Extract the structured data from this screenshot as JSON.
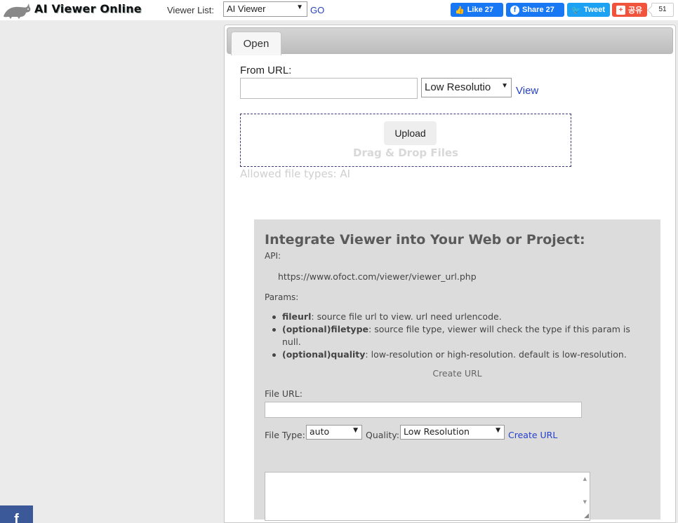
{
  "header": {
    "logo_text": "AI Viewer Online",
    "viewer_list_label": "Viewer List:",
    "viewer_select_value": "AI Viewer",
    "go_label": "GO",
    "social": {
      "like_label": "Like 27",
      "share_label": "Share 27",
      "tweet_label": "Tweet",
      "kakao_share_label": "공유",
      "count": "51"
    }
  },
  "tabs": [
    {
      "label": "Open"
    }
  ],
  "open_panel": {
    "from_url_label": "From URL:",
    "url_input_value": "",
    "resolution_select_value": "Low Resolutio",
    "view_label": "View",
    "upload_label": "Upload",
    "drag_drop_text": "Drag & Drop Files",
    "allowed_text": "Allowed file types: AI"
  },
  "integrate": {
    "title": "Integrate Viewer into Your Web or Project:",
    "api_label": "API:",
    "api_url": "https://www.ofoct.com/viewer/viewer_url.php",
    "params_label": "Params:",
    "params": [
      {
        "name": "fileurl",
        "desc": ": source file url to view. url need urlencode."
      },
      {
        "name": "(optional)filetype",
        "desc": ": source file type, viewer will check the type if this param is null."
      },
      {
        "name": "(optional)quality",
        "desc": ": low-resolution or high-resolution. default is low-resolution."
      }
    ],
    "create_url_caption": "Create URL",
    "file_url_label": "File URL:",
    "file_url_value": "",
    "file_type_label": "File Type:",
    "file_type_value": "auto",
    "quality_label": "Quality:",
    "quality_value": "Low Resolution",
    "create_url_link": "Create URL"
  },
  "floating": {
    "facebook_glyph": "f"
  },
  "colors": {
    "link": "#2540c8",
    "facebook": "#1877f2",
    "twitter": "#1da1f2",
    "kakao": "#f0543c"
  }
}
